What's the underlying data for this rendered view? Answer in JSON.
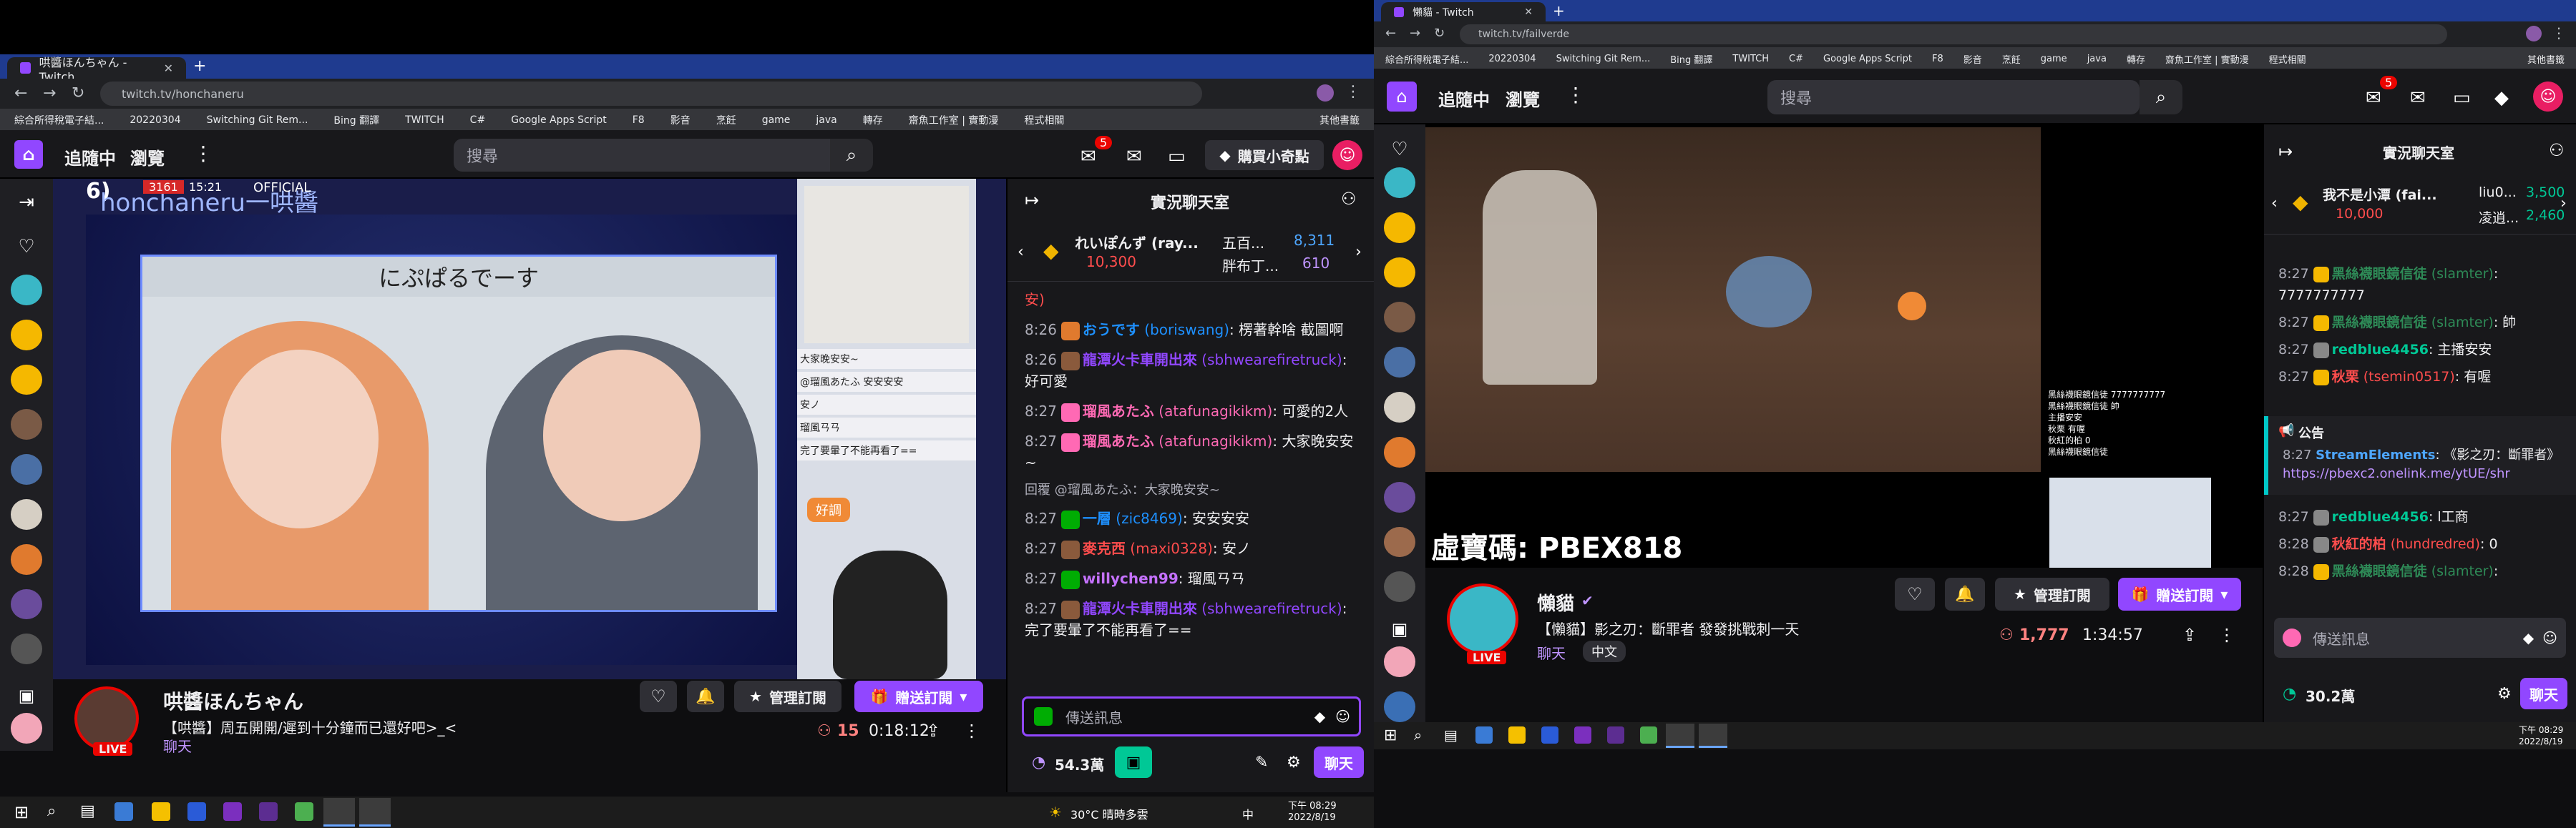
{
  "left": {
    "tab_title": "哄醬ほんちゃん - Twitch",
    "url": "twitch.tv/honchaneru",
    "bookmarks": [
      "綜合所得稅電子結...",
      "20220304",
      "Switching Git Rem...",
      "Bing 翻譯",
      "TWITCH",
      "C#",
      "Google Apps Script",
      "F8",
      "影音",
      "烹飪",
      "game",
      "java",
      "轉存",
      "齋魚工作室 | 實動漫",
      "程式相關",
      "其他書籤"
    ],
    "nav_following": "追隨中",
    "nav_browse": "瀏覽",
    "search_placeholder": "搜尋",
    "notif_count": "5",
    "bits_button": "購買小奇點",
    "video_banner_name": "honchaneru一哄醬",
    "video_banner_official": "OFFICIAL",
    "video_caption": "にぷぱるでーす",
    "video_count": "6)",
    "video_live_tag": "3161",
    "video_time": "15:21",
    "overlay_chat": [
      "大家晚安安~",
      "@瑠風あたふ 安安安安",
      "安ノ",
      "瑠風ㄢㄢ",
      "完了要暈了不能再看了=="
    ],
    "overlay_good": "好調",
    "streamer_name": "哄醬ほんちゃん",
    "stream_title": "【哄醬】周五開開/遲到十分鐘而已還好吧>_<",
    "category": "聊天",
    "live_label": "LIVE",
    "manage_sub": "管理訂閱",
    "gift_sub": "贈送訂閱",
    "viewers": "15",
    "uptime": "0:18:12",
    "chat_header": "實況聊天室",
    "leader": {
      "first_name": "れいぽんず (ray...",
      "first_value": "10,300",
      "second_name": "五百...",
      "second_value": "8,311",
      "third_name": "胖布丁...",
      "third_value": "610"
    },
    "chat_messages": [
      {
        "time": "",
        "user": "",
        "color": "#ff4d4d",
        "text": "安)"
      },
      {
        "time": "8:26",
        "user": "おうです",
        "alt": "(boriswang)",
        "color": "#1e90ff",
        "text": ": 楞著幹啥 截圖啊"
      },
      {
        "time": "8:26",
        "user": "龍潭火卡車開出來",
        "alt": "(sbhwearefiretruck)",
        "color": "#9147ff",
        "text": ": 好可愛"
      },
      {
        "time": "8:27",
        "user": "瑠風あたふ",
        "alt": "(atafunagikikm)",
        "color": "#ff69b4",
        "text": ": 可愛的2人"
      },
      {
        "time": "8:27",
        "user": "瑠風あたふ",
        "alt": "(atafunagikikm)",
        "color": "#ff69b4",
        "text": ": 大家晚安安~"
      },
      {
        "time": "8:27",
        "user": "一層",
        "alt": "(zic8469)",
        "color": "#1e90ff",
        "text": ": 安安安安",
        "reply": "回覆 @瑠風あたふ：大家晚安安~"
      },
      {
        "time": "8:27",
        "user": "麥克西",
        "alt": "(maxi0328)",
        "color": "#ff4d4d",
        "text": ": 安ノ"
      },
      {
        "time": "8:27",
        "user": "willychen99",
        "alt": "",
        "color": "#c471ff",
        "text": ": 瑠風ㄢㄢ"
      },
      {
        "time": "8:27",
        "user": "龍潭火卡車開出來",
        "alt": "(sbhwearefiretruck)",
        "color": "#9147ff",
        "text": ": 完了要暈了不能再看了=="
      }
    ],
    "chat_placeholder": "傳送訊息",
    "points": "54.3萬",
    "chat_button": "聊天",
    "taskbar_temp": "30°C 晴時多雲",
    "taskbar_ime": "中",
    "taskbar_time": "下午 08:29",
    "taskbar_date": "2022/8/19"
  },
  "right": {
    "tab_title": "懶貓 - Twitch",
    "url": "twitch.tv/failverde",
    "bookmarks": [
      "綜合所得稅電子結...",
      "20220304",
      "Switching Git Rem...",
      "Bing 翻譯",
      "TWITCH",
      "C#",
      "Google Apps Script",
      "F8",
      "影音",
      "烹飪",
      "game",
      "java",
      "轉存",
      "齋魚工作室 | 實動漫",
      "程式相關",
      "其他書籤"
    ],
    "nav_following": "追隨中",
    "nav_browse": "瀏覽",
    "search_placeholder": "搜尋",
    "notif_count": "5",
    "code_text": "虛寶碼: PBEX818",
    "overlay_chat": [
      "黑絲襪眼鏡信徒 7777777777",
      "黑絲襪眼鏡信徒 帥",
      "主播安安",
      "秋栗 有喔",
      "秋紅的柏 0",
      "黑絲襪眼鏡信徒"
    ],
    "streamer_name": "懶貓",
    "stream_title": "【懶貓】影之刃：斷罪者 發發挑戰刺一天",
    "category": "聊天",
    "tag": "中文",
    "live_label": "LIVE",
    "manage_sub": "管理訂閱",
    "gift_sub": "贈送訂閱",
    "viewers": "1,777",
    "uptime": "1:34:57",
    "chat_header": "實況聊天室",
    "leader": {
      "first_name": "我不是小潭 (fai...",
      "first_value": "10,000",
      "second_name": "liu0...",
      "second_value": "3,500",
      "third_name": "凌逍...",
      "third_value": "2,460"
    },
    "chat_messages": [
      {
        "time": "8:27",
        "user": "黑絲襪眼鏡信徒",
        "alt": "(slamter)",
        "color": "#2e8b57",
        "text": ": 7777777777"
      },
      {
        "time": "8:27",
        "user": "黑絲襪眼鏡信徒",
        "alt": "(slamter)",
        "color": "#2e8b57",
        "text": ": 帥"
      },
      {
        "time": "8:27",
        "user": "redblue4456",
        "alt": "",
        "color": "#00c896",
        "text": ": 主播安安"
      },
      {
        "time": "8:27",
        "user": "秋栗",
        "alt": "(tsemin0517)",
        "color": "#ff4d4d",
        "text": ": 有喔"
      }
    ],
    "announcement_label": "公告",
    "announcement": {
      "time": "8:27",
      "user": "StreamElements",
      "text": "《影之刃：斷罪者》",
      "link": "https://pbexc2.onelink.me/ytUE/shr"
    },
    "chat_messages2": [
      {
        "time": "8:27",
        "user": "redblue4456",
        "alt": "",
        "color": "#00c896",
        "text": ": l工商"
      },
      {
        "time": "8:28",
        "user": "秋紅的柏",
        "alt": "(hundredred)",
        "color": "#ff4d4d",
        "text": ": 0"
      },
      {
        "time": "8:28",
        "user": "黑絲襪眼鏡信徒",
        "alt": "(slamter)",
        "color": "#2e8b57",
        "text": ":"
      }
    ],
    "chat_placeholder": "傳送訊息",
    "points": "30.2萬",
    "chat_button": "聊天",
    "taskbar_time": "下午 08:29",
    "taskbar_date": "2022/8/19"
  }
}
